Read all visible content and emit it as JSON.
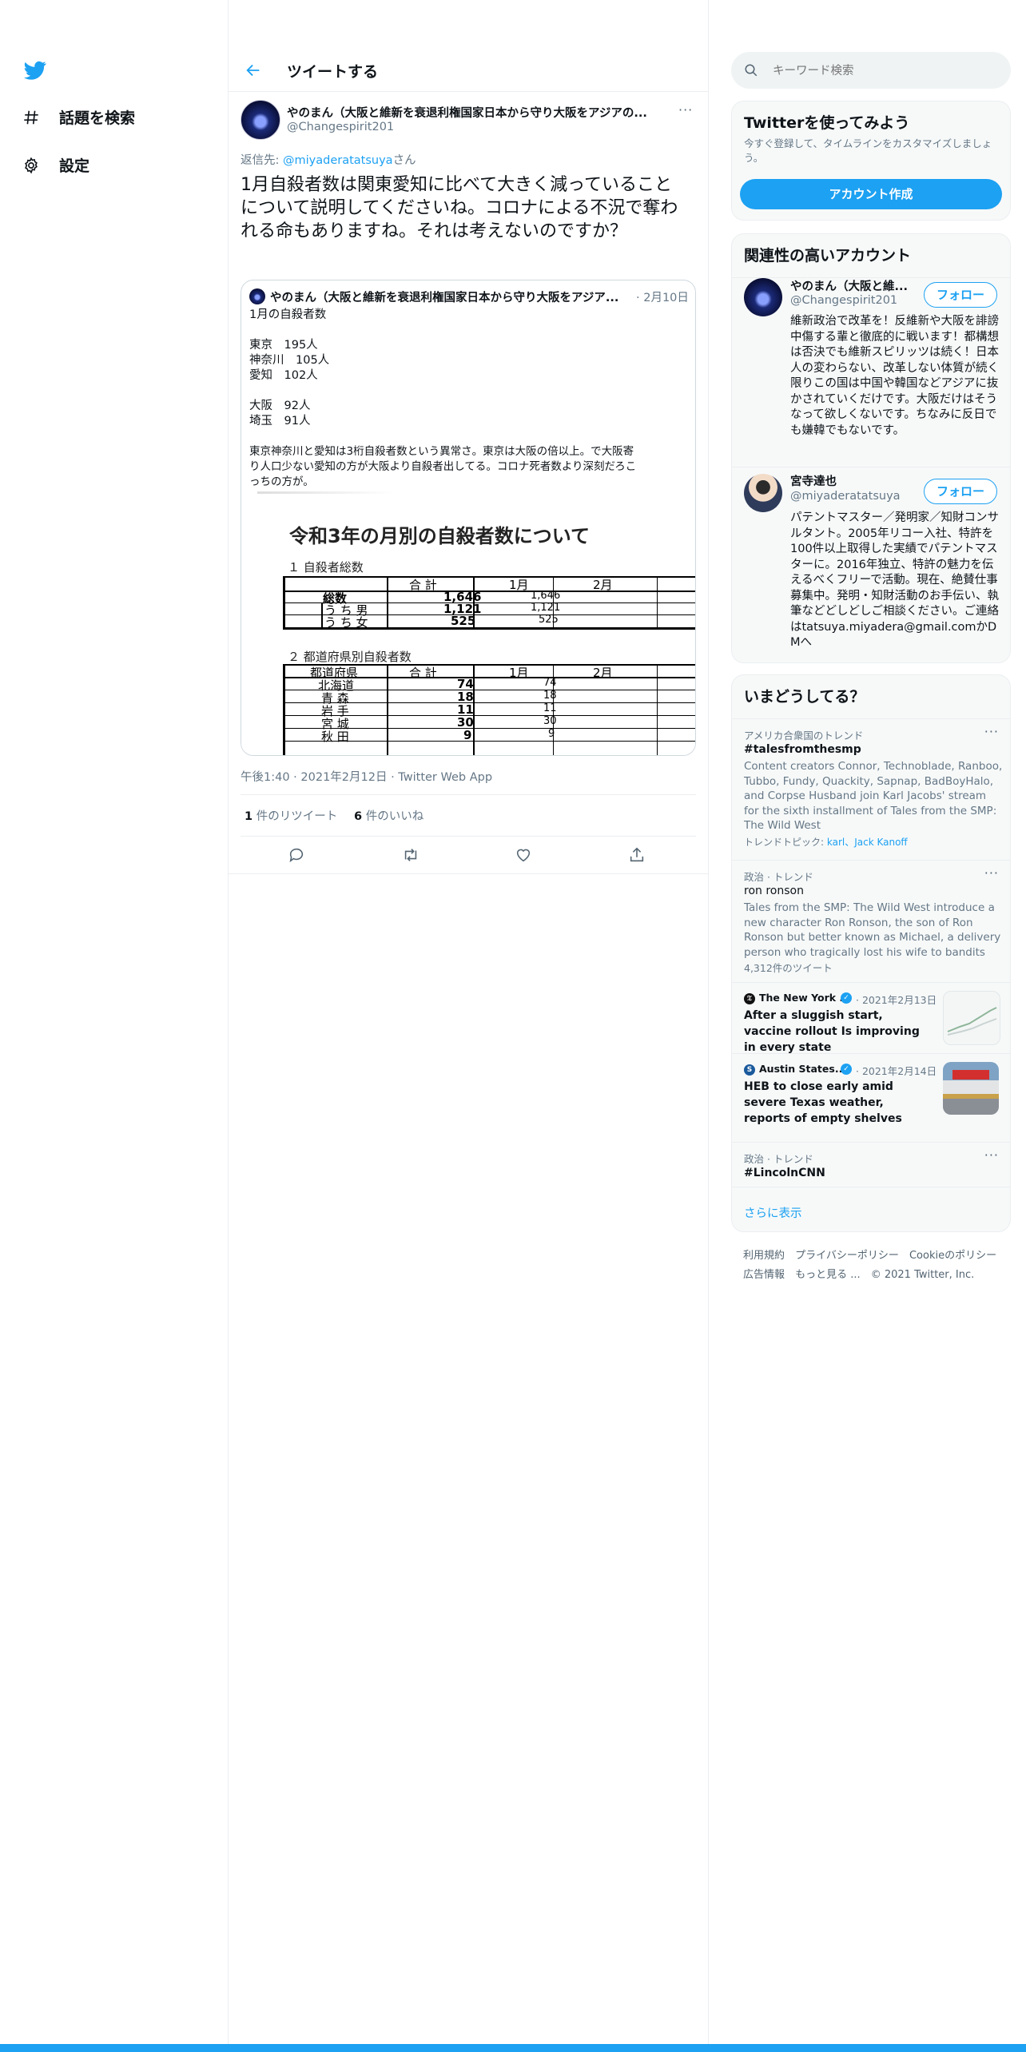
{
  "nav": {
    "items": [
      {
        "label": "話題を検索",
        "icon": "hashtag-icon"
      },
      {
        "label": "設定",
        "icon": "gear-icon"
      }
    ]
  },
  "header": {
    "title": "ツイートする"
  },
  "tweet": {
    "author_name": "やのまん（大阪と維新を衰退利権国家日本から守り大阪をアジアの...",
    "author_handle": "@Changespirit201",
    "reply_prefix": "返信先: ",
    "reply_to": "@miyaderatatsuya",
    "reply_suffix": "さん",
    "text": "1月自殺者数は関東愛知に比べて大きく減っていることについて説明してくださいね。コロナによる不況で奪われる命もありますね。それは考えないのですか？",
    "timestamp": "午後1:40 · 2021年2月12日 · Twitter Web App",
    "retweets_count": "1",
    "retweets_label": "件のリツイート",
    "likes_count": "6",
    "likes_label": "件のいいね",
    "quote": {
      "author_name": "やのまん（大阪と維新を衰退利権国家日本から守り大阪をアジア...",
      "date": "· 2月10日",
      "lines": [
        "1月の自殺者数",
        "",
        "東京　195人",
        "神奈川　105人",
        "愛知　102人",
        "",
        "大阪　92人",
        "埼玉　91人",
        "",
        "東京神奈川と愛知は3桁自殺者数という異常さ。東京は大阪の倍以上。で大阪寄",
        "り人口少ない愛知の方が大阪より自殺者出してる。コロナ死者数より深刻だろこ",
        "っちの方が。"
      ],
      "doc": {
        "title": "令和3年の月別の自殺者数について",
        "section1": "１ 自殺者総数",
        "section2": "２ 都道府県別自殺者数",
        "headers": [
          "合 計",
          "1月",
          "2月"
        ],
        "row_total": {
          "label": "総数",
          "total": "1,646",
          "jan": "1,646"
        },
        "row_male": {
          "label": "う ち 男",
          "total": "1,121",
          "jan": "1,121"
        },
        "row_female": {
          "label": "う ち 女",
          "total": "525",
          "jan": "525"
        },
        "pref_header": "都道府県",
        "prefs": [
          {
            "name": "北海道",
            "total": "74",
            "jan": "74"
          },
          {
            "name": "青 森",
            "total": "18",
            "jan": "18"
          },
          {
            "name": "岩 手",
            "total": "11",
            "jan": "11"
          },
          {
            "name": "宮 城",
            "total": "30",
            "jan": "30"
          },
          {
            "name": "秋 田",
            "total": "9",
            "jan": "9"
          }
        ]
      }
    }
  },
  "search": {
    "placeholder": "キーワード検索"
  },
  "signup": {
    "title": "Twitterを使ってみよう",
    "subtitle": "今すぐ登録して、タイムラインをカスタマイズしましょう。",
    "button": "アカウント作成"
  },
  "relevant": {
    "title": "関連性の高いアカウント",
    "follow_label": "フォロー",
    "accounts": [
      {
        "name": "やのまん（大阪と維...",
        "handle": "@Changespirit201",
        "bio": "維新政治で改革を！反維新や大阪を誹謗中傷する輩と徹底的に戦います！都構想は否決でも維新スピリッツは続く！日本人の変わらない、改革しない体質が続く限りこの国は中国や韓国などアジアに抜かされていくだけです。大阪だけはそうなって欲しくないです。ちなみに反日でも嫌韓でもないです。"
      },
      {
        "name": "宮寺達也",
        "handle": "@miyaderatatsuya",
        "bio": "パテントマスター／発明家／知財コンサルタント。2005年リコー入社、特許を100件以上取得した実績でパテントマスターに。2016年独立、特許の魅力を伝えるべくフリーで活動。現在、絶賛仕事募集中。発明・知財活動のお手伝い、執筆などどしどしご相談ください。ご連絡はtatsuya.miyadera@gmail.comかDMへ"
      }
    ]
  },
  "trends": {
    "title": "いまどうしてる？",
    "items": [
      {
        "context": "アメリカ合衆国のトレンド",
        "name": "#talesfromthesmp",
        "desc": "Content creators Connor, Technoblade, Ranboo, Tubbo, Fundy, Quackity, Sapnap, BadBoyHalo, and Corpse Husband join Karl Jacobs' stream for the sixth installment of Tales from the SMP: The Wild West",
        "topics_label": "トレンドトピック: ",
        "topics": "karl、Jack Kanoff"
      },
      {
        "context": "政治 · トレンド",
        "name": "ron ronson",
        "desc": "Tales from the SMP: The Wild West introduce a new character Ron Ronson, the son of Ron Ronson but better known as Michael, a delivery person who tragically lost his wife to bandits",
        "count": "4,312件のツイート"
      }
    ],
    "news": [
      {
        "source": "The New York ...",
        "date": "· 2021年2月13日",
        "headline": "After a sluggish start, vaccine rollout Is improving in every state"
      },
      {
        "source": "Austin States...",
        "date": "· 2021年2月14日",
        "headline": "HEB to close early amid severe Texas weather, reports of empty shelves"
      }
    ],
    "last": {
      "context": "政治 · トレンド",
      "name": "#LincolnCNN"
    },
    "show_more": "さらに表示"
  },
  "footer": {
    "links": [
      "利用規約",
      "プライバシーポリシー",
      "Cookieのポリシー",
      "広告情報",
      "もっと見る ...",
      "© 2021 Twitter, Inc."
    ]
  },
  "colors": {
    "accent": "#1da1f2",
    "text": "#0f1419",
    "muted": "#657786"
  }
}
